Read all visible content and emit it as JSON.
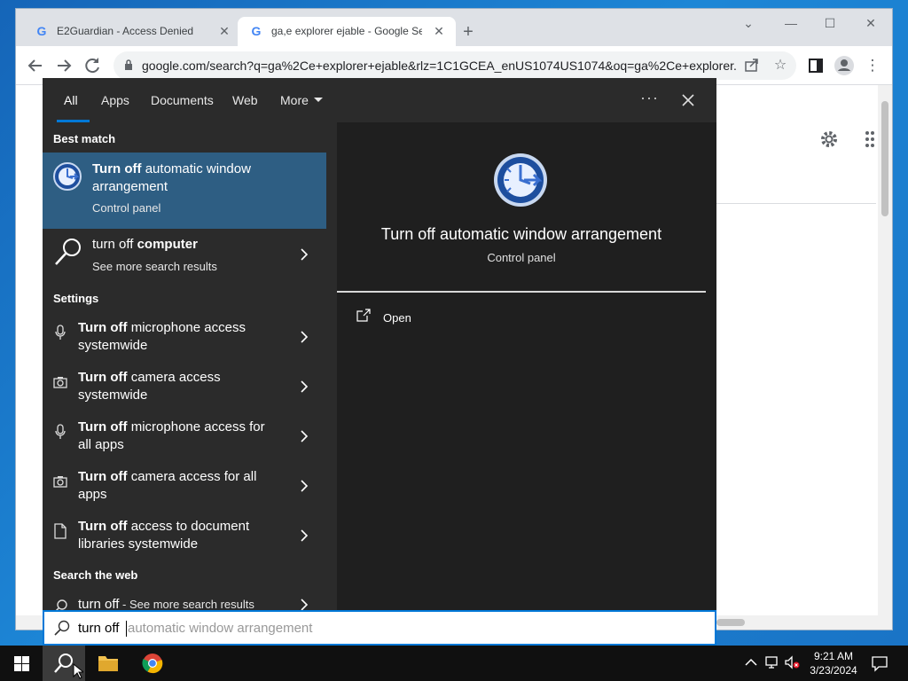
{
  "browser": {
    "tabs": [
      {
        "title": "E2Guardian - Access Denied",
        "favicon": "google-g-icon",
        "active": false
      },
      {
        "title": "ga,e explorer ejable - Google Search",
        "favicon": "google-g-icon",
        "active": true
      }
    ],
    "url": "google.com/search?q=ga%2Ce+explorer+ejable&rlz=1C1GCEA_enUS1074US1074&oq=ga%2Ce+explorer..."
  },
  "search_panel": {
    "nav_tabs": [
      "All",
      "Apps",
      "Documents",
      "Web",
      "More"
    ],
    "active_tab": "All",
    "sections": {
      "best_match": "Best match",
      "settings": "Settings",
      "web": "Search the web"
    },
    "best_match": {
      "title_bold": "Turn off",
      "title_rest": " automatic window arrangement",
      "subtitle": "Control panel"
    },
    "computer_result": {
      "title_normal": "turn off ",
      "title_bold": "computer",
      "subtitle": "See more search results"
    },
    "settings_items": [
      {
        "bold": "Turn off",
        "rest": " microphone access systemwide",
        "icon": "microphone-icon"
      },
      {
        "bold": "Turn off",
        "rest": " camera access systemwide",
        "icon": "camera-icon"
      },
      {
        "bold": "Turn off",
        "rest": " microphone access for all apps",
        "icon": "microphone-icon"
      },
      {
        "bold": "Turn off",
        "rest": " camera access for all apps",
        "icon": "camera-icon"
      },
      {
        "bold": "Turn off",
        "rest": " access to document libraries systemwide",
        "icon": "document-icon"
      }
    ],
    "web_result": {
      "query": "turn off",
      "suffix": " - See more search results"
    },
    "detail": {
      "title": "Turn off automatic window arrangement",
      "subtitle": "Control panel",
      "actions": [
        {
          "label": "Open",
          "icon": "open-icon"
        }
      ]
    }
  },
  "search_box": {
    "typed": "turn off",
    "suggestion": "automatic window arrangement"
  },
  "taskbar": {
    "time": "9:21 AM",
    "date": "3/23/2024"
  },
  "colors": {
    "accent": "#0078d7",
    "best_match_bg": "#2e5e83",
    "panel_bg": "#2b2b2b",
    "detail_bg": "#1f1f1f",
    "taskbar_bg": "#101010"
  }
}
